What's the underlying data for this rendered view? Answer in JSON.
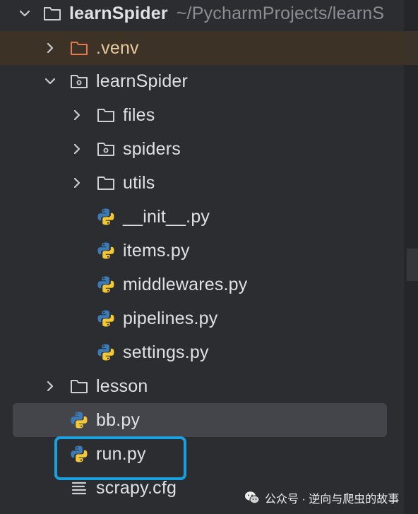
{
  "tree": {
    "root": {
      "name": "learnSpider",
      "path": "~/PycharmProjects/learnS"
    },
    "items": [
      {
        "label": ".venv",
        "icon": "folder-icon"
      },
      {
        "label": "learnSpider",
        "icon": "package-folder-icon"
      },
      {
        "label": "files",
        "icon": "folder-icon"
      },
      {
        "label": "spiders",
        "icon": "package-folder-icon"
      },
      {
        "label": "utils",
        "icon": "folder-icon"
      },
      {
        "label": "__init__.py",
        "icon": "python-file-icon"
      },
      {
        "label": "items.py",
        "icon": "python-file-icon"
      },
      {
        "label": "middlewares.py",
        "icon": "python-file-icon"
      },
      {
        "label": "pipelines.py",
        "icon": "python-file-icon"
      },
      {
        "label": "settings.py",
        "icon": "python-file-icon"
      },
      {
        "label": "lesson",
        "icon": "folder-icon"
      },
      {
        "label": "bb.py",
        "icon": "python-file-icon"
      },
      {
        "label": "run.py",
        "icon": "python-file-icon"
      },
      {
        "label": "scrapy.cfg",
        "icon": "text-file-icon"
      }
    ]
  },
  "watermark": {
    "text": "公众号 · 逆向与爬虫的故事"
  },
  "colors": {
    "background": "#2b2d30",
    "excluded_row": "#3d3226",
    "selected_row": "#43454a",
    "highlight_border": "#1aa0e0",
    "python_blue": "#3d7ab8",
    "python_yellow": "#f3c834"
  }
}
